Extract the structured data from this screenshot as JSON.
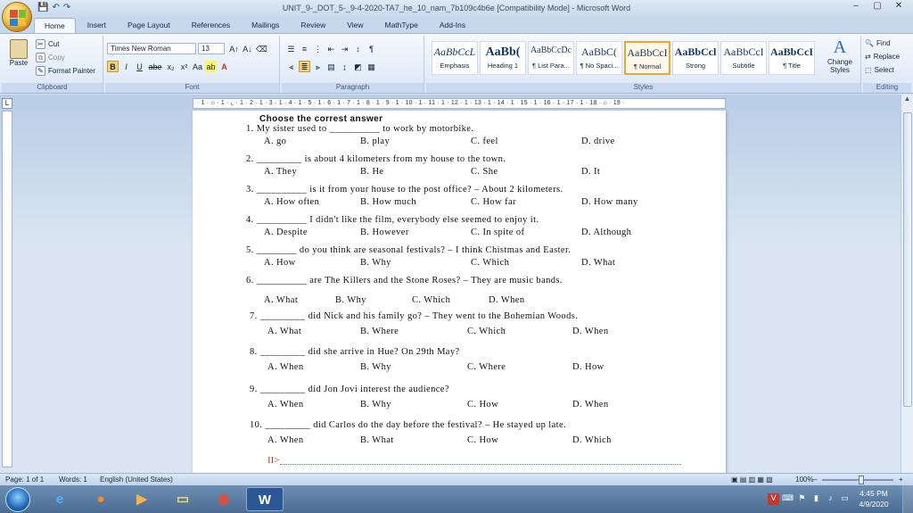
{
  "window": {
    "title": "UNIT_9-_DOT_5-_9-4-2020-TA7_he_10_nam_7b109c4b6e [Compatibility Mode] - Microsoft Word",
    "minimize": "–",
    "restore": "▢",
    "close": "✕"
  },
  "qat": {
    "save": "💾",
    "undo": "↶",
    "redo": "↷"
  },
  "tabs": [
    "Home",
    "Insert",
    "Page Layout",
    "References",
    "Mailings",
    "Review",
    "View",
    "MathType",
    "Add-Ins"
  ],
  "clipboard": {
    "paste": "Paste",
    "cut": "Cut",
    "copy": "Copy",
    "format_painter": "Format Painter",
    "label": "Clipboard"
  },
  "font": {
    "name": "Times New Roman",
    "size": "13",
    "label": "Font",
    "buttons": [
      "B",
      "I",
      "U",
      "abe",
      "x₂",
      "x²",
      "Aa"
    ]
  },
  "paragraph": {
    "label": "Paragraph"
  },
  "styles": {
    "label": "Styles",
    "items": [
      {
        "sample": "AaBbCcL",
        "name": "Emphasis"
      },
      {
        "sample": "AaBb(",
        "name": "Heading 1"
      },
      {
        "sample": "AaBbCcDc",
        "name": "¶ List Para..."
      },
      {
        "sample": "AaBbC(",
        "name": "¶ No Spaci..."
      },
      {
        "sample": "AaBbCcI",
        "name": "¶ Normal"
      },
      {
        "sample": "AaBbCcl",
        "name": "Strong"
      },
      {
        "sample": "AaBbCcI",
        "name": "Subtitle"
      },
      {
        "sample": "AaBbCcI",
        "name": "¶ Title"
      }
    ],
    "change_styles": "Change Styles"
  },
  "editing": {
    "label": "Editing",
    "find": "Find",
    "replace": "Replace",
    "select": "Select"
  },
  "ruler": {
    "marks": "· 1 · ⌂ · 1 · ⌞ · 1 · 2 · 1 · 3 · 1 · 4 · 1 · 5 · 1 · 6 · 1 · 7 · 1 · 8 · 1 · 9 · 1 · 10 · 1 · 11 · 1 · 12 · 1 · 13 · 1 · 14 · 1 · 15 · 1 · 16 · 1 · 17 · 1 · 18 · ⌂ · 19 ·"
  },
  "document": {
    "heading": "Choose the correst answer",
    "questions": [
      {
        "text": "1.   My sister used to __________ to work by motorbike.",
        "options": [
          "A. go",
          "B. play",
          "C. feel",
          "D. drive"
        ]
      },
      {
        "text": "2.   _________ is about 4 kilometers from my house to the town.",
        "options": [
          "A. They",
          "B. He",
          "C. She",
          "D. It"
        ]
      },
      {
        "text": "3.   __________ is it from your house to the post office? – About 2 kilometers.",
        "options": [
          "A. How often",
          "B. How much",
          "C. How far",
          "D. How many"
        ]
      },
      {
        "text": "4.   __________ I didn't like the film, everybody else seemed to enjoy it.",
        "options": [
          "A. Despite",
          "B. However",
          "C. In spite of",
          "D. Although"
        ]
      },
      {
        "text": "5. ________ do you think are seasonal festivals? – I think Chistmas and Easter.",
        "options": [
          "A. How",
          "B. Why",
          "C. Which",
          "D. What"
        ]
      },
      {
        "text": "6. __________ are The Killers and the Stone Roses? – They are music bands.",
        "options": [
          "A. What",
          "B. Why",
          "C. Which",
          "D. When"
        ]
      },
      {
        "text": "7. _________ did Nick and his family go? – They went to the Bohemian Woods.",
        "options": [
          "A. What",
          "B. Where",
          "C. Which",
          "D. When"
        ]
      },
      {
        "text": "8. _________ did she arrive in Hue? On 29th May?",
        "options": [
          "A. When",
          "B. Why",
          "C. Where",
          "D. How"
        ]
      },
      {
        "text": "9. _________ did Jon Jovi interest the audience?",
        "options": [
          "A. When",
          "B. Why",
          "C. How",
          "D. When"
        ]
      },
      {
        "text": "10. _________ did Carlos do the day before the festival? – He stayed up late.",
        "options": [
          "A. When",
          "B. What",
          "C. How",
          "D. Which"
        ]
      }
    ],
    "section_next": "II>"
  },
  "statusbar": {
    "page": "Page: 1 of 1",
    "words": "Words: 1",
    "language": "English (United States)",
    "zoom": "100%",
    "zoom_minus": "–",
    "zoom_plus": "+"
  },
  "taskbar": {
    "time": "4:45 PM",
    "date": "4/9/2020",
    "word_icon": "W"
  },
  "colors": {
    "accent": "#e8a640",
    "ribbon": "#dbe7f6",
    "taskbar": "#4a6c91",
    "highlight": "#f8cf7a"
  }
}
